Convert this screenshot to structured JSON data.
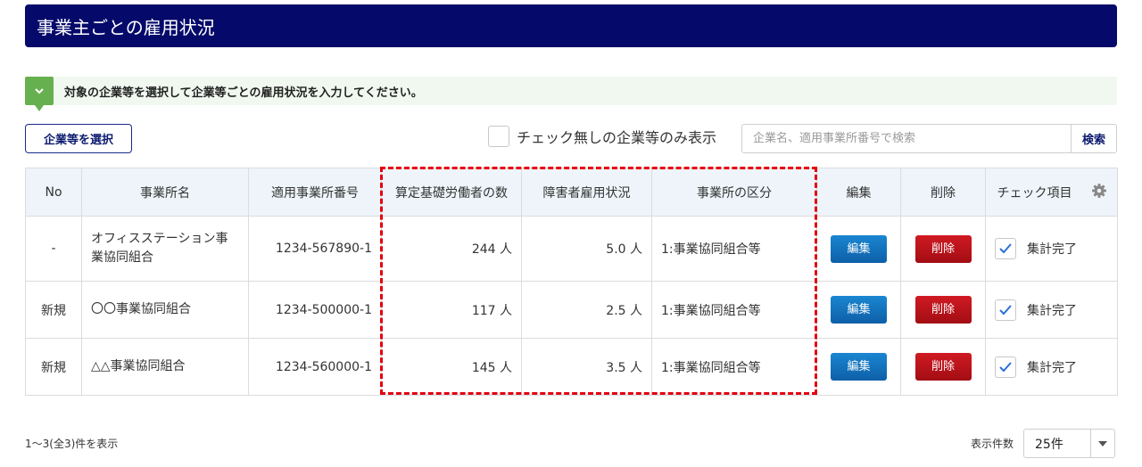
{
  "header": {
    "title": "事業主ごとの雇用状況"
  },
  "notice": {
    "icon": "chevron-down-icon",
    "text": "対象の企業等を選択して企業等ごとの雇用状況を入力してください。",
    "color": "#67b04f"
  },
  "toolbar": {
    "select_button": "企業等を選択",
    "filter_label": "チェック無しの企業等のみ表示",
    "search_placeholder": "企業名、適用事業所番号で検索",
    "search_button": "検索"
  },
  "table": {
    "headers": [
      "No",
      "事業所名",
      "適用事業所番号",
      "算定基礎労働者の数",
      "障害者雇用状況",
      "事業所の区分",
      "編集",
      "削除",
      "チェック項目"
    ],
    "rows": [
      {
        "no": "-",
        "name": "オフィスステーション事業協同組合",
        "number": "1234-567890-1",
        "workers": "244 人",
        "employment": "5.0 人",
        "kubun": "1:事業協同組合等",
        "edit": "編集",
        "delete": "削除",
        "check_label": "集計完了",
        "checked": true
      },
      {
        "no": "新規",
        "name": "〇〇事業協同組合",
        "number": "1234-500000-1",
        "workers": "117 人",
        "employment": "2.5 人",
        "kubun": "1:事業協同組合等",
        "edit": "編集",
        "delete": "削除",
        "check_label": "集計完了",
        "checked": true
      },
      {
        "no": "新規",
        "name": "△△事業協同組合",
        "number": "1234-560000-1",
        "workers": "145 人",
        "employment": "3.5 人",
        "kubun": "1:事業協同組合等",
        "edit": "編集",
        "delete": "削除",
        "check_label": "集計完了",
        "checked": true
      }
    ]
  },
  "footer": {
    "count_text": "1〜3(全3)件を表示",
    "per_page_label": "表示件数",
    "per_page_value": "25件"
  },
  "colors": {
    "header_bg": "#050a6a",
    "edit_button": "#0e5fa8",
    "delete_button": "#c0121b",
    "highlight": "#e3000f"
  }
}
